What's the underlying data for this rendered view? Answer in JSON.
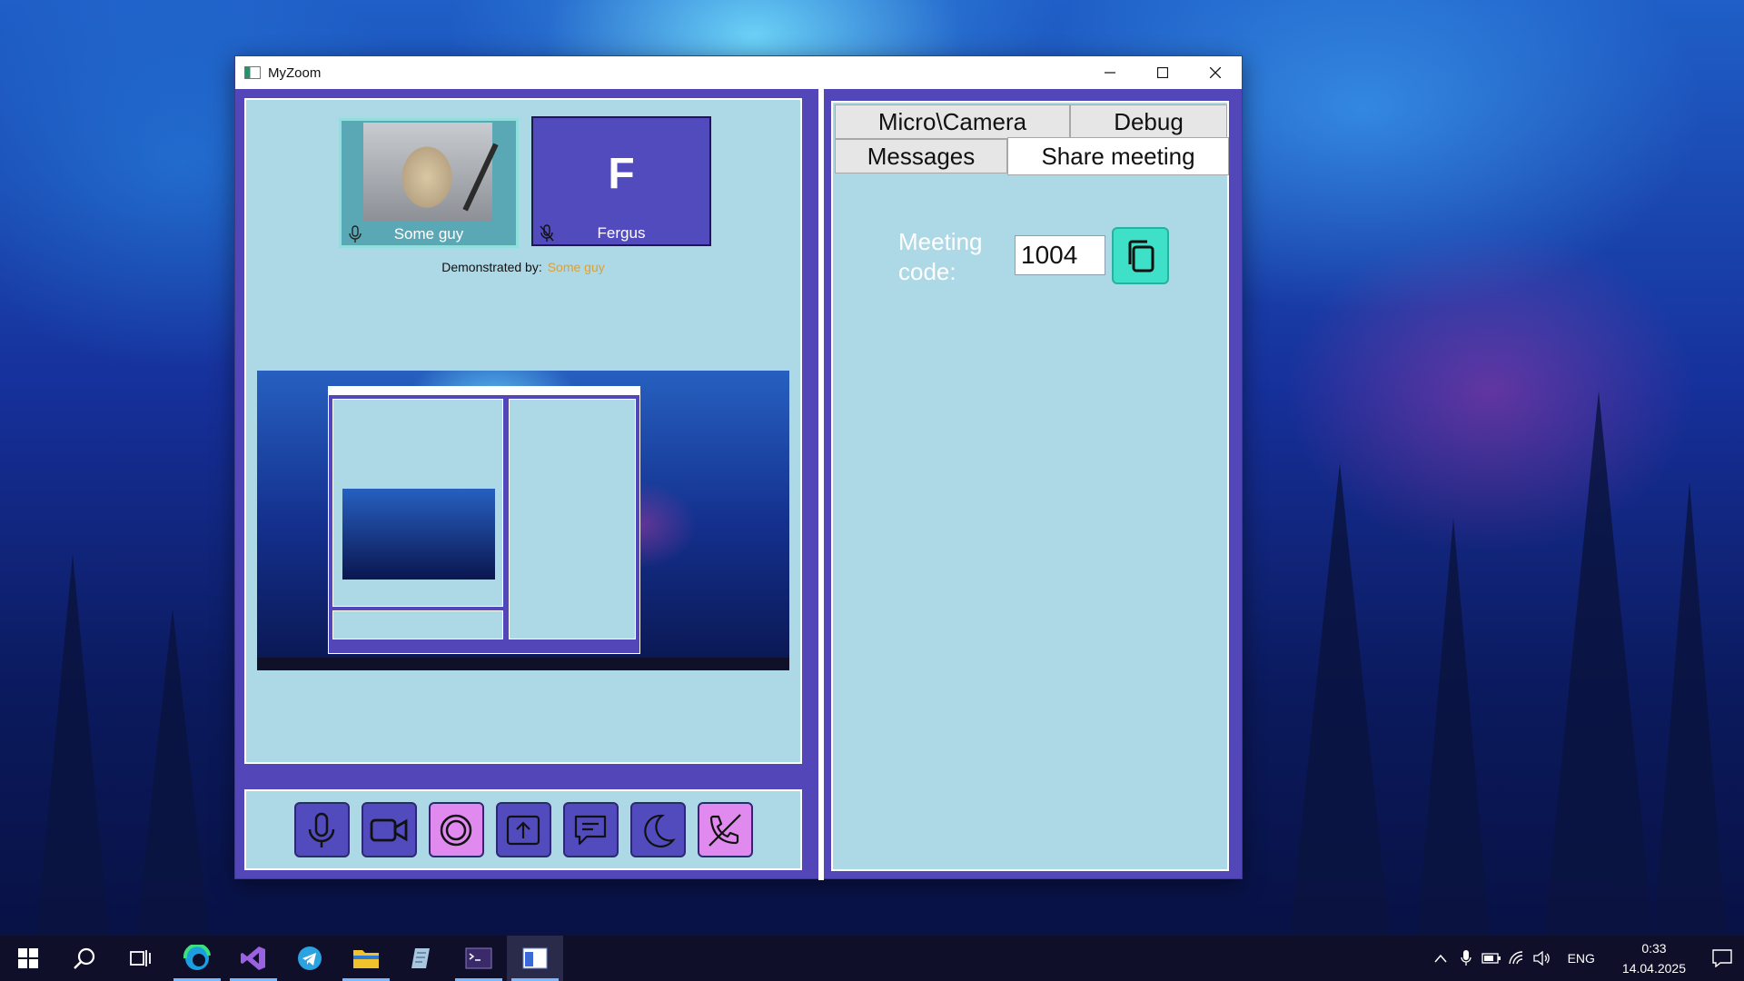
{
  "window": {
    "title": "MyZoom",
    "controls": [
      "minimize",
      "maximize",
      "close"
    ]
  },
  "participants": [
    {
      "name": "Some guy",
      "avatar": "webcam-video",
      "mic": "on"
    },
    {
      "name": "Fergus",
      "avatar_letter": "F",
      "mic": "muted"
    }
  ],
  "demonstration": {
    "label": "Demonstrated by:",
    "presenter": "Some guy",
    "presenter_color": "#e0a030"
  },
  "controls": [
    {
      "name": "microphone-icon",
      "style": "normal"
    },
    {
      "name": "camera-icon",
      "style": "normal"
    },
    {
      "name": "screen-share-icon",
      "style": "active-pink"
    },
    {
      "name": "upload-icon",
      "style": "normal"
    },
    {
      "name": "chat-icon",
      "style": "normal"
    },
    {
      "name": "moon-icon",
      "style": "normal"
    },
    {
      "name": "hang-up-icon",
      "style": "active-pink"
    }
  ],
  "tabs": [
    {
      "label": "Micro\\Camera",
      "active": false
    },
    {
      "label": "Debug",
      "active": false
    },
    {
      "label": "Messages",
      "active": false
    },
    {
      "label": "Share meeting",
      "active": true
    }
  ],
  "share_meeting": {
    "label": "Meeting code:",
    "code": "1004",
    "copy_icon": "copy-icon"
  },
  "colors": {
    "window_frame": "#5246b8",
    "pane_background": "#add8e6",
    "accent_pink": "#e08af0",
    "copy_button": "#3ee0c8"
  },
  "taskbar": {
    "apps": [
      "start",
      "search",
      "task-view",
      "edge",
      "visual-studio",
      "telegram",
      "file-explorer",
      "notepad",
      "terminal",
      "myzoom"
    ],
    "language": "ENG",
    "time": "0:33",
    "date": "14.04.2025"
  }
}
